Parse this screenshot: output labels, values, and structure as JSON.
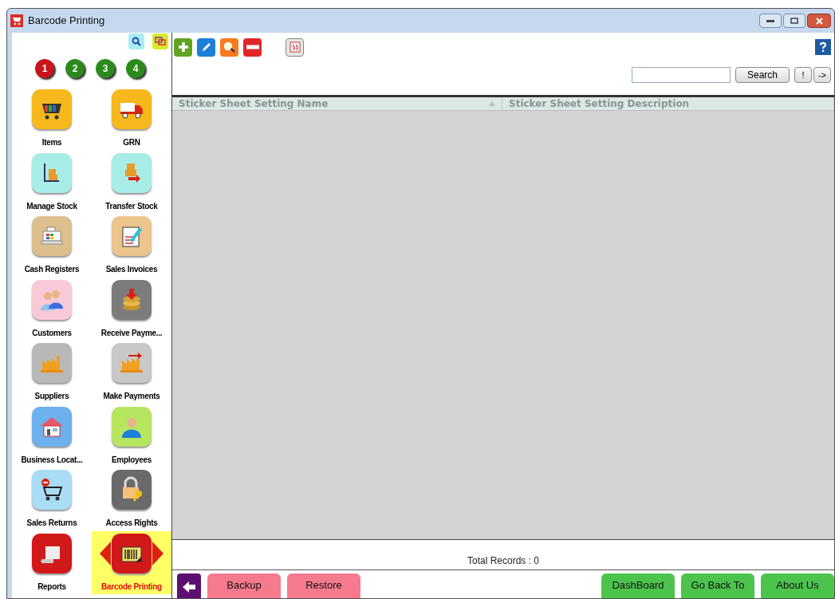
{
  "window": {
    "title": "Barcode Printing"
  },
  "sidebar": {
    "steps": [
      {
        "label": "1",
        "selected": true
      },
      {
        "label": "2",
        "selected": false
      },
      {
        "label": "3",
        "selected": false
      },
      {
        "label": "4",
        "selected": false
      }
    ],
    "items": [
      {
        "label": "Items",
        "kind": "cart",
        "color": "#f6b81c",
        "selected": false
      },
      {
        "label": "GRN",
        "kind": "truck",
        "color": "#f6b81c",
        "selected": false
      },
      {
        "label": "Manage Stock",
        "kind": "trolley",
        "color": "#a8ece6",
        "selected": false
      },
      {
        "label": "Transfer Stock",
        "kind": "transfer",
        "color": "#a8ece6",
        "selected": false
      },
      {
        "label": "Cash Registers",
        "kind": "register",
        "color": "#ddbf8e",
        "selected": false
      },
      {
        "label": "Sales Invoices",
        "kind": "invoice",
        "color": "#ecc58c",
        "selected": false
      },
      {
        "label": "Customers",
        "kind": "people",
        "color": "#f9c9d8",
        "selected": false
      },
      {
        "label": "Receive Payme...",
        "kind": "coins",
        "color": "#7c7c7c",
        "selected": false
      },
      {
        "label": "Suppliers",
        "kind": "factory",
        "color": "#b8b8b8",
        "selected": false
      },
      {
        "label": "Make Payments",
        "kind": "factory-arrow",
        "color": "#c8c8c8",
        "selected": false
      },
      {
        "label": "Business Locat...",
        "kind": "house",
        "color": "#6db0ee",
        "selected": false
      },
      {
        "label": "Employees",
        "kind": "person",
        "color": "#b6e660",
        "selected": false
      },
      {
        "label": "Sales Returns",
        "kind": "cart-minus",
        "color": "#a9dcf5",
        "selected": false
      },
      {
        "label": "Access Rights",
        "kind": "lock",
        "color": "#6a6a6a",
        "selected": false
      },
      {
        "label": "Reports",
        "kind": "scroll",
        "color": "#d11919",
        "selected": false
      },
      {
        "label": "Barcode Printing",
        "kind": "barcode",
        "color": "#d11919",
        "selected": true
      }
    ]
  },
  "search": {
    "button": "Search",
    "extra_buttons": [
      "!",
      "->"
    ]
  },
  "table": {
    "columns": [
      {
        "label": "Sticker Sheet Setting Name",
        "sorted": true
      },
      {
        "label": "Sticker Sheet Setting Description",
        "sorted": false
      }
    ]
  },
  "total_records": "Total Records : 0",
  "bottom_buttons": [
    {
      "label": "Backup",
      "kind": "pink"
    },
    {
      "label": "Restore",
      "kind": "pink"
    },
    {
      "label": "DashBoard",
      "kind": "green"
    },
    {
      "label": "Go Back To",
      "kind": "green"
    },
    {
      "label": "About Us",
      "kind": "green"
    }
  ]
}
